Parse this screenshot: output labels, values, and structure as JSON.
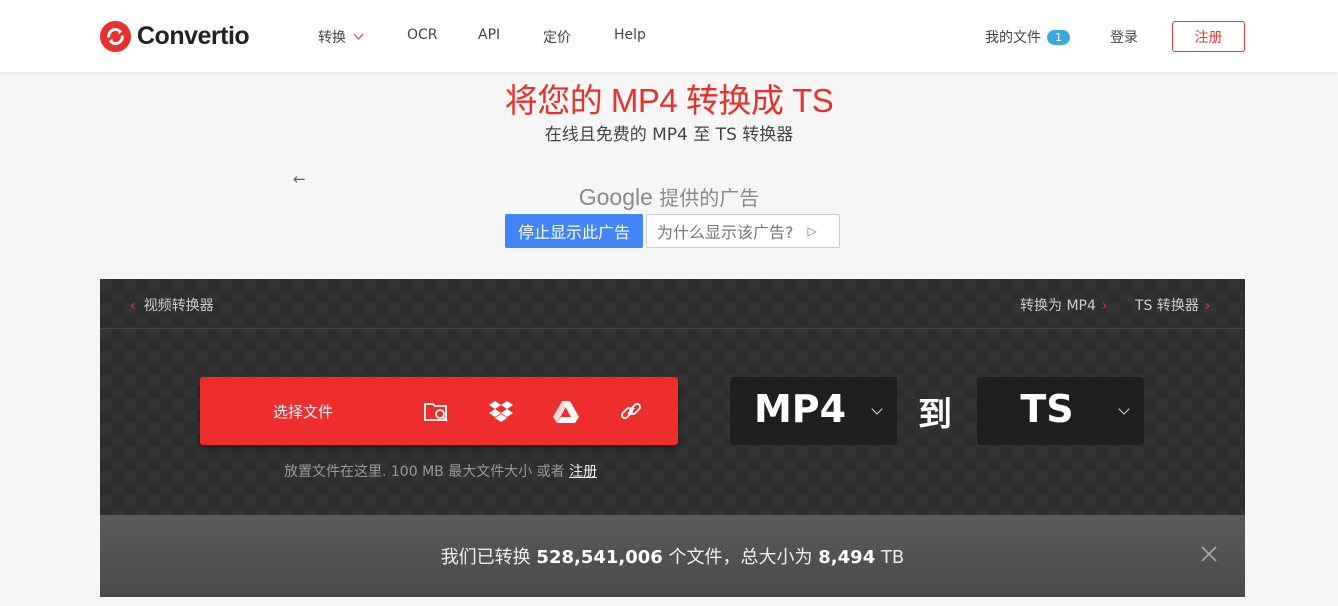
{
  "brand": {
    "name": "Convertio",
    "accent": "#e8302c"
  },
  "nav": {
    "convert": "转换",
    "ocr": "OCR",
    "api": "API",
    "pricing": "定价",
    "help": "Help",
    "my_files": "我的文件",
    "my_files_count": "1",
    "login": "登录",
    "signup": "注册"
  },
  "hero": {
    "title": "将您的 MP4 转换成 TS",
    "subtitle": "在线且免费的 MP4 至 TS 转换器"
  },
  "ad": {
    "back_icon": "arrow-left-icon",
    "google": "Google",
    "provided": "提供的广告",
    "stop_label": "停止显示此广告",
    "why_label": "为什么显示该广告?"
  },
  "converter": {
    "crumb_back": "视频转换器",
    "crumb_to_mp4": "转换为 MP4",
    "crumb_ts": "TS 转换器",
    "choose_files": "选择文件",
    "upload_icons": [
      "folder-search-icon",
      "dropbox-icon",
      "google-drive-icon",
      "link-icon"
    ],
    "drop_hint": "放置文件在这里. 100 MB 最大文件大小 或者 ",
    "drop_hint_link": "注册",
    "from_format": "MP4",
    "to_word": "到",
    "to_format": "TS"
  },
  "stats": {
    "prefix": "我们已转换 ",
    "files": "528,541,006",
    "middle": " 个文件，总大小为 ",
    "size": "8,494",
    "unit": " TB"
  }
}
